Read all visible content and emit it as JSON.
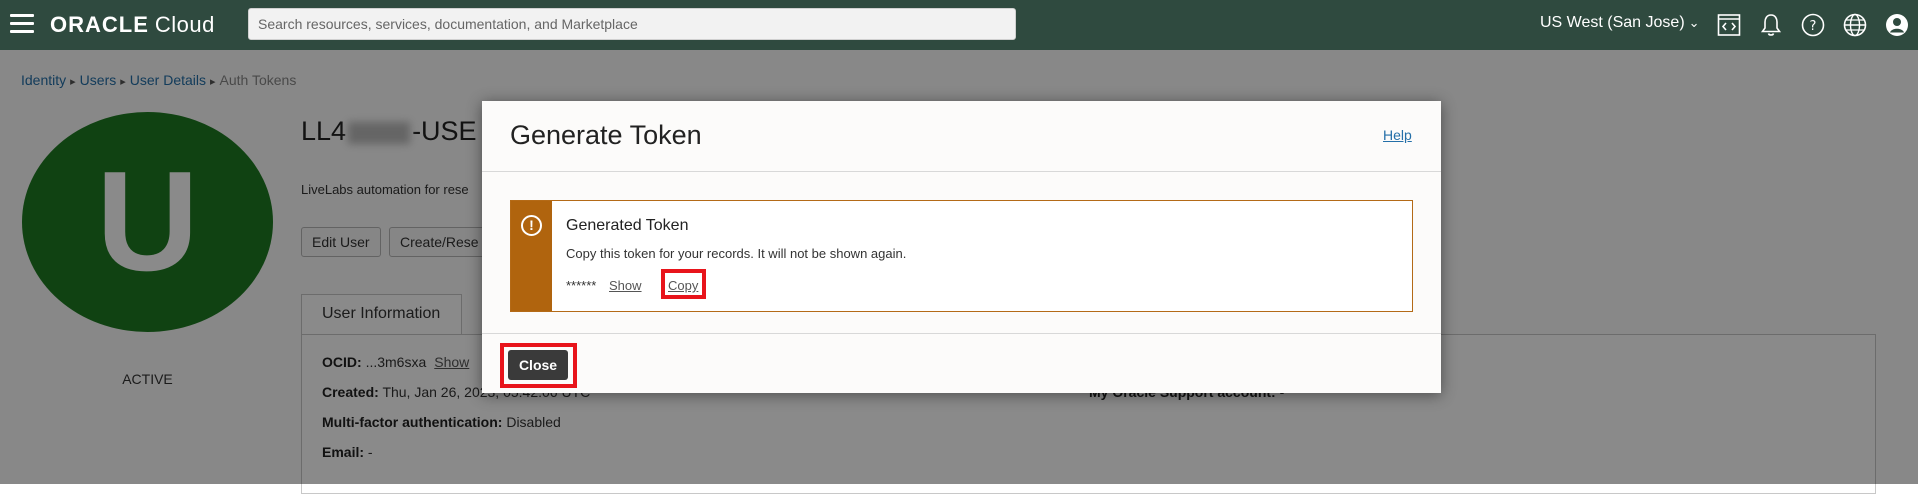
{
  "topbar": {
    "brand_oracle": "ORACLE",
    "brand_cloud": "Cloud",
    "search_placeholder": "Search resources, services, documentation, and Marketplace",
    "region": "US West (San Jose)",
    "bg_color": "#2f4a3f",
    "icons": [
      "code-editor-icon",
      "bell-icon",
      "help-icon",
      "globe-icon",
      "user-profile-icon"
    ]
  },
  "breadcrumb": {
    "items": [
      "Identity",
      "Users",
      "User Details"
    ],
    "current": "Auth Tokens"
  },
  "user": {
    "avatar_letter": "U",
    "avatar_color": "#1e7b22",
    "status": "ACTIVE",
    "title_prefix": "LL4",
    "title_suffix": "-USE",
    "description": "LiveLabs automation for rese",
    "buttons": {
      "edit": "Edit User",
      "create_reset": "Create/Rese"
    }
  },
  "tabs": {
    "user_information": "User Information"
  },
  "info": {
    "ocid_label": "OCID:",
    "ocid_value": "...3m6sxa",
    "ocid_show": "Show",
    "created_label": "Created:",
    "created_value": "Thu, Jan 26, 2023, 05:42:06 UTC",
    "mfa_label": "Multi-factor authentication:",
    "mfa_value": "Disabled",
    "email_label": "Email:",
    "email_value": "-",
    "support_label": "My Oracle Support account:",
    "support_value": "-"
  },
  "modal": {
    "title": "Generate Token",
    "help": "Help",
    "alert": {
      "title": "Generated Token",
      "message": "Copy this token for your records. It will not be shown again.",
      "token_mask": "******",
      "show": "Show",
      "copy": "Copy",
      "accent_color": "#b0640e"
    },
    "close": "Close",
    "highlight_color": "#e8141b"
  }
}
